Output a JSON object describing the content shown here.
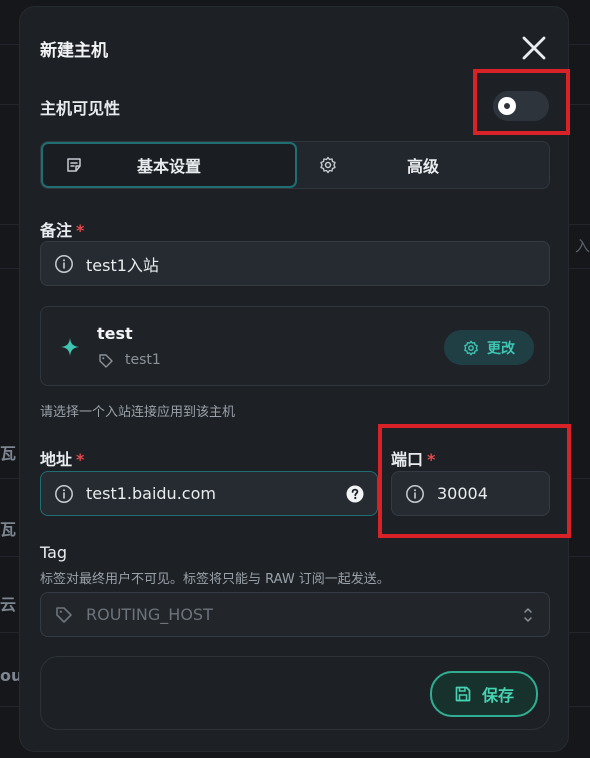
{
  "background": {
    "left_labels": [
      "瓦",
      "瓦",
      "云",
      "ou"
    ],
    "right_label": "入"
  },
  "modal": {
    "title": "新建主机",
    "visibility_label": "主机可见性",
    "visibility_enabled": false,
    "tabs": [
      {
        "label": "基本设置",
        "active": true
      },
      {
        "label": "高级",
        "active": false
      }
    ],
    "remark": {
      "label": "备注",
      "required_mark": "*",
      "value": "test1入站"
    },
    "inbound": {
      "name": "test",
      "tag": "test1",
      "change_label": "更改"
    },
    "inbound_hint": "请选择一个入站连接应用到该主机",
    "address": {
      "label": "地址",
      "required_mark": "*",
      "value": "test1.baidu.com"
    },
    "port": {
      "label": "端口",
      "required_mark": "*",
      "value": "30004"
    },
    "tag_field": {
      "label": "Tag",
      "description": "标签对最终用户不可见。标签将只能与 RAW 订阅一起发送。",
      "placeholder": "ROUTING_HOST"
    },
    "save_label": "保存"
  },
  "colors": {
    "accent": "#3ec6b2",
    "required": "#e5484d",
    "highlight": "#d92228"
  }
}
